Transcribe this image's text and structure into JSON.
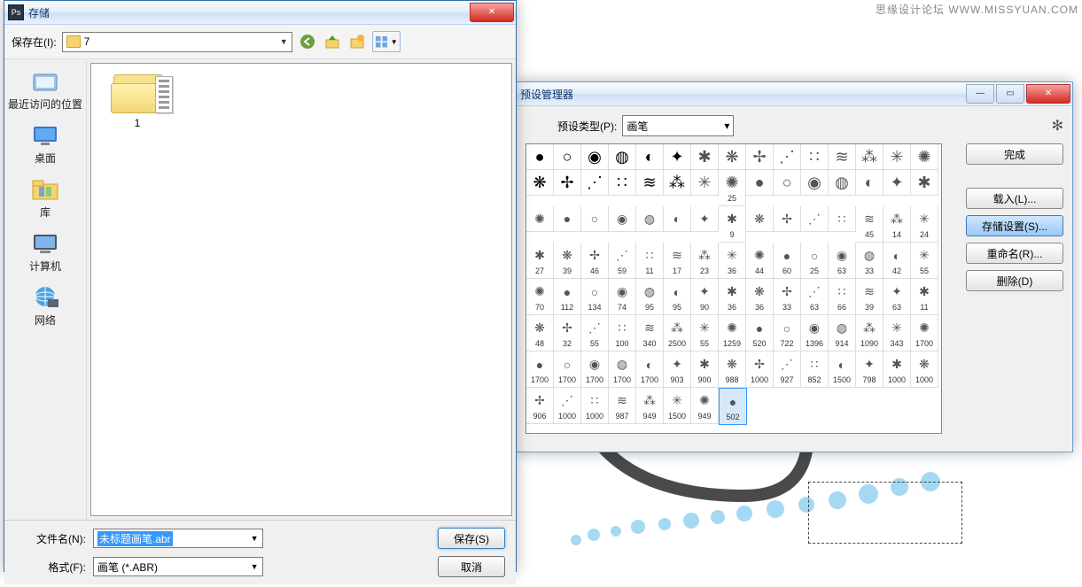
{
  "watermark": "思缘设计论坛 WWW.MISSYUAN.COM",
  "canvas": {
    "folder_label": "1"
  },
  "preset_manager": {
    "title": "预设管理器",
    "type_label": "预设类型(P):",
    "type_value": "画笔",
    "buttons": {
      "done": "完成",
      "load": "载入(L)...",
      "save_set": "存储设置(S)...",
      "rename": "重命名(R)...",
      "delete": "删除(D)"
    },
    "brush_rows": [
      [
        "",
        "",
        "",
        "",
        "",
        "",
        "",
        "",
        "",
        "",
        "",
        "",
        "",
        "",
        ""
      ],
      [
        "",
        "",
        "",
        "",
        "",
        "",
        "",
        "25",
        "",
        "",
        "",
        "",
        "",
        "",
        ""
      ],
      [
        "",
        "",
        "",
        "",
        "",
        "",
        "",
        "9",
        "",
        "",
        "",
        "",
        "45",
        "14",
        "24"
      ],
      [
        "27",
        "39",
        "46",
        "59",
        "11",
        "17",
        "23",
        "36",
        "44",
        "60",
        "25",
        "63",
        "33",
        "42"
      ],
      [
        "55",
        "70",
        "112",
        "134",
        "74",
        "95",
        "95",
        "90",
        "36",
        "36",
        "33",
        "63",
        "66",
        "39"
      ],
      [
        "63",
        "11",
        "48",
        "32",
        "55",
        "100",
        "340",
        "2500",
        "55",
        "1259",
        "520",
        "722",
        "1396",
        "914"
      ],
      [
        "1090",
        "343",
        "1700",
        "1700",
        "1700",
        "1700",
        "1700",
        "1700",
        "903",
        "900",
        "988",
        "1000",
        "927",
        "852"
      ],
      [
        "1500",
        "798",
        "1000",
        "1000",
        "906",
        "1000",
        "1000",
        "987",
        "949",
        "1500",
        "949",
        "502"
      ]
    ],
    "selected": {
      "row": 7,
      "col": 11
    }
  },
  "save_dialog": {
    "title": "存储",
    "save_in_label": "保存在(I):",
    "save_in_value": "7",
    "places": [
      {
        "key": "recent",
        "label": "最近访问的位置"
      },
      {
        "key": "desktop",
        "label": "桌面"
      },
      {
        "key": "libraries",
        "label": "库"
      },
      {
        "key": "computer",
        "label": "计算机"
      },
      {
        "key": "network",
        "label": "网络"
      }
    ],
    "filename_label": "文件名(N):",
    "filename_value": "未标题画笔.abr",
    "format_label": "格式(F):",
    "format_value": "画笔 (*.ABR)",
    "save_btn": "保存(S)",
    "cancel_btn": "取消"
  }
}
